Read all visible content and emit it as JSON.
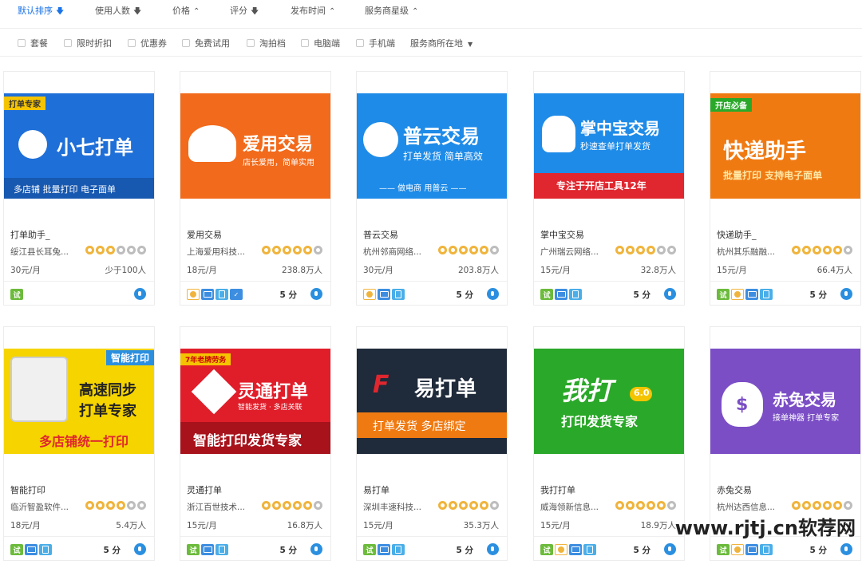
{
  "sort": [
    {
      "label": "默认排序",
      "icon": "arrow-down-icon",
      "active": true
    },
    {
      "label": "使用人数",
      "icon": "arrow-down-icon",
      "active": false
    },
    {
      "label": "价格",
      "icon": "sort-updown-icon",
      "active": false
    },
    {
      "label": "评分",
      "icon": "arrow-down-icon",
      "active": false
    },
    {
      "label": "发布时间",
      "icon": "sort-updown-icon",
      "active": false
    },
    {
      "label": "服务商星级",
      "icon": "sort-updown-icon",
      "active": false
    }
  ],
  "filters": [
    "套餐",
    "限时折扣",
    "优惠券",
    "免费试用",
    "淘拍档",
    "电脑端",
    "手机端"
  ],
  "location_filter": "服务商所在地",
  "cards": [
    {
      "name": "打单助手_",
      "company": "绥江县长耳兔...",
      "stars": 3,
      "price": "30元/月",
      "users": "少于100人",
      "score": "",
      "badges": [
        "try"
      ],
      "banner": {
        "bg": "#1f6fd8",
        "tag": "打单专家",
        "title": "小七打单",
        "sub": "多店铺  批量打印  电子面单"
      }
    },
    {
      "name": "爱用交易",
      "company": "上海爱用科技...",
      "stars": 5,
      "price": "18元/月",
      "users": "238.8万人",
      "score": "5 分",
      "badges": [
        "medal",
        "pc",
        "mobile",
        "shield"
      ],
      "banner": {
        "bg": "#f26a1b",
        "title": "爱用交易",
        "sub": "店长爱用，简单实用"
      }
    },
    {
      "name": "普云交易",
      "company": "杭州邻商网络...",
      "stars": 5,
      "price": "30元/月",
      "users": "203.8万人",
      "score": "5 分",
      "badges": [
        "medal",
        "pc",
        "mobile"
      ],
      "banner": {
        "bg": "#1e8be8",
        "title": "普云交易",
        "sub": "打单发货  简单高效",
        "foot": "—— 做电商  用普云 ——"
      }
    },
    {
      "name": "掌中宝交易",
      "company": "广州瑞云网络...",
      "stars": 4,
      "price": "15元/月",
      "users": "32.8万人",
      "score": "5 分",
      "badges": [
        "try",
        "pc",
        "mobile"
      ],
      "banner": {
        "bg": "#1e8be8",
        "title": "掌中宝交易",
        "sub": "秒速查单打单发货",
        "foot": "专注于开店工具12年"
      }
    },
    {
      "name": "快递助手_",
      "company": "杭州其乐融融...",
      "stars": 5,
      "price": "15元/月",
      "users": "66.4万人",
      "score": "5 分",
      "badges": [
        "try",
        "medal",
        "pc",
        "mobile"
      ],
      "banner": {
        "bg": "#f07a12",
        "tag": "开店必备",
        "title": "快递助手",
        "sub": "批量打印  支持电子面单"
      }
    },
    {
      "name": "智能打印",
      "company": "临沂智盈软件...",
      "stars": 4,
      "price": "18元/月",
      "users": "5.4万人",
      "score": "5 分",
      "badges": [
        "try",
        "pc",
        "mobile"
      ],
      "banner": {
        "bg": "#f5d400",
        "tag": "智能打印",
        "title": "高速同步",
        "title2": "打单专家",
        "foot": "多店铺统一打印"
      }
    },
    {
      "name": "灵通打单",
      "company": "浙江百世技术...",
      "stars": 5,
      "price": "15元/月",
      "users": "16.8万人",
      "score": "5 分",
      "badges": [
        "try",
        "pc",
        "mobile"
      ],
      "banner": {
        "bg": "#e01e2a",
        "tag": "7年老牌劳务",
        "title": "灵通打单",
        "sub": "智能发货 · 多店关联",
        "foot": "智能打印发货专家"
      }
    },
    {
      "name": "易打单",
      "company": "深圳丰速科技...",
      "stars": 5,
      "price": "15元/月",
      "users": "35.3万人",
      "score": "5 分",
      "badges": [
        "try",
        "pc",
        "mobile"
      ],
      "banner": {
        "bg": "#1f2a3a",
        "title": "易打单",
        "foot": "打单发货    多店绑定"
      }
    },
    {
      "name": "我打打单",
      "company": "威海领新信息...",
      "stars": 5,
      "price": "15元/月",
      "users": "18.9万人",
      "score": "5 分",
      "badges": [
        "try",
        "medal",
        "pc",
        "mobile"
      ],
      "banner": {
        "bg": "#2aa829",
        "title": "我打",
        "ver": "6.0",
        "sub": "打印发货专家"
      }
    },
    {
      "name": "赤兔交易",
      "company": "杭州达西信息...",
      "stars": 5,
      "price": "",
      "users": "",
      "score": "5 分",
      "badges": [
        "try",
        "medal",
        "pc",
        "mobile"
      ],
      "banner": {
        "bg": "#7b4ec6",
        "title": "赤兔交易",
        "sub": "接单神器  打单专家"
      }
    }
  ],
  "watermark": "www.rjtj.cn软荐网"
}
